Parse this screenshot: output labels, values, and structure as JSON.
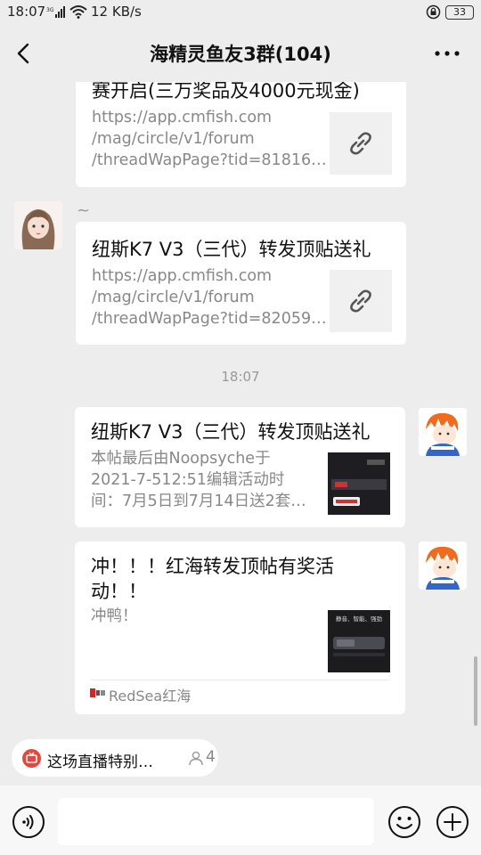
{
  "status_bar": {
    "time": "18:07",
    "network_speed": "12 KB/s",
    "battery": "33"
  },
  "header": {
    "title": "海精灵鱼友3群(104)"
  },
  "messages": [
    {
      "title": "赛开启(三万奖品及4000元现金)",
      "desc": "https://app.cmfish.com\n/mag/circle/v1/forum\n/threadWapPage?tid=81816…",
      "thumb": "link-icon"
    },
    {
      "sender_remark": "~",
      "title": "纽斯K7 V3（三代）转发顶贴送礼",
      "desc": "https://app.cmfish.com\n/mag/circle/v1/forum\n/threadWapPage?tid=82059…",
      "thumb": "link-icon"
    },
    {
      "title": "纽斯K7 V3（三代）转发顶贴送礼",
      "desc": "本帖最后由Noopsyche于\n2021-7-512:51编辑活动时\n间：7月5日到7月14日送2套…",
      "thumb": "product-image"
    },
    {
      "title_line1": "冲！！！红海转发顶帖有奖活",
      "title_line2": "动！！",
      "desc": "冲鸭！",
      "source": "RedSea红海",
      "thumb": "product-image",
      "thumb_text": "静音、智能、强劲"
    }
  ],
  "timestamp": "18:07",
  "live_pill": {
    "text": "这场直播特别…",
    "count": "4"
  },
  "input": {
    "placeholder": ""
  },
  "colors": {
    "background": "#ededed",
    "card": "#ffffff",
    "live_icon": "#e8453c"
  }
}
